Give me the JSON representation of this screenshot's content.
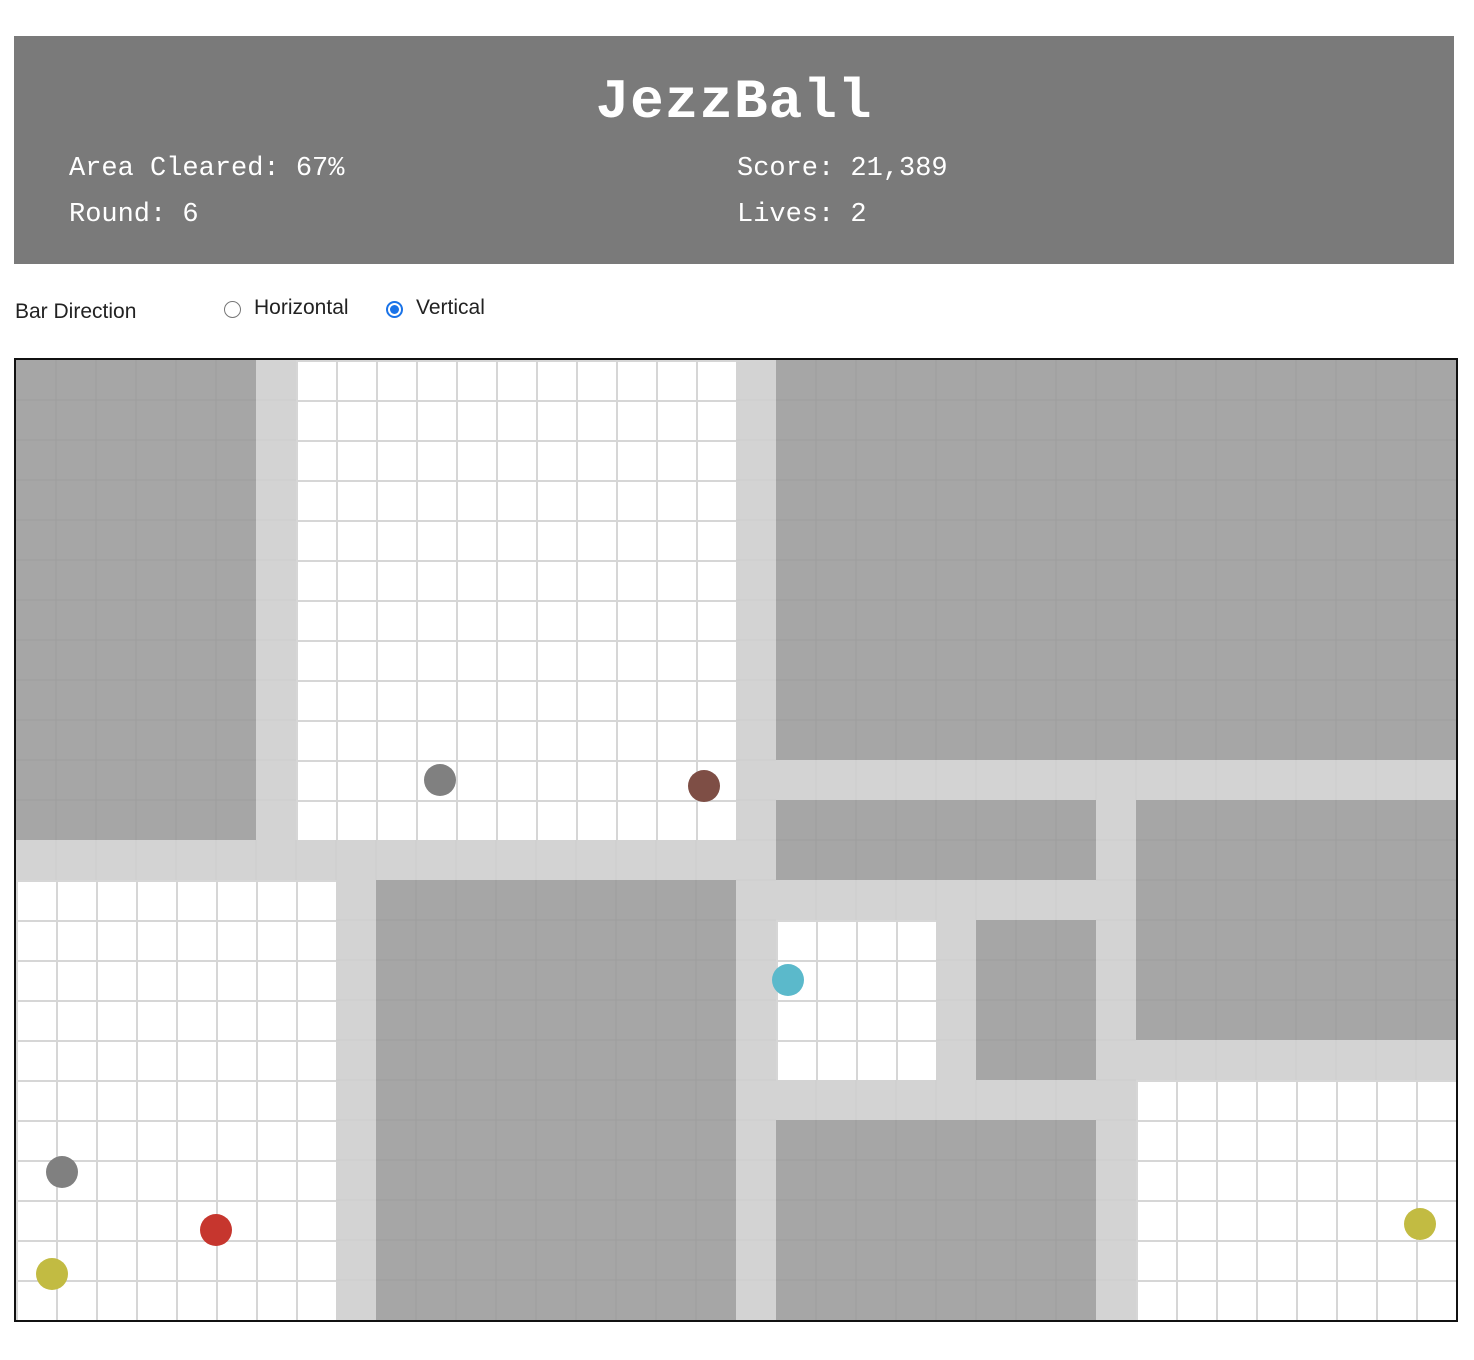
{
  "game": {
    "title": "JezzBall",
    "stats": {
      "area_cleared": "Area Cleared: 67%",
      "score": "Score: 21,389",
      "round": "Round: 6",
      "lives": "Lives: 2"
    }
  },
  "controls": {
    "bar_direction_label": "Bar Direction",
    "options": [
      {
        "label": "Horizontal",
        "checked": false
      },
      {
        "label": "Vertical",
        "checked": true
      }
    ]
  },
  "board": {
    "columns": 36,
    "rows": 24,
    "colors": {
      "filled": "#a6a6a6",
      "wall": "#d3d3d3",
      "open": "#ffffff",
      "gridline": "#d6d6d6"
    },
    "regions": [
      {
        "type": "filled",
        "col": 0,
        "row": 0,
        "cols": 6,
        "rows": 12
      },
      {
        "type": "wall",
        "col": 6,
        "row": 0,
        "cols": 1,
        "rows": 12
      },
      {
        "type": "open",
        "col": 7,
        "row": 0,
        "cols": 11,
        "rows": 12
      },
      {
        "type": "wall",
        "col": 18,
        "row": 0,
        "cols": 1,
        "rows": 24
      },
      {
        "type": "filled",
        "col": 19,
        "row": 0,
        "cols": 17,
        "rows": 10
      },
      {
        "type": "wall",
        "col": 19,
        "row": 10,
        "cols": 17,
        "rows": 1
      },
      {
        "type": "wall",
        "col": 0,
        "row": 12,
        "cols": 18,
        "rows": 1
      },
      {
        "type": "open",
        "col": 0,
        "row": 13,
        "cols": 8,
        "rows": 11
      },
      {
        "type": "wall",
        "col": 8,
        "row": 13,
        "cols": 1,
        "rows": 11
      },
      {
        "type": "filled",
        "col": 9,
        "row": 13,
        "cols": 9,
        "rows": 11
      },
      {
        "type": "filled",
        "col": 19,
        "row": 11,
        "cols": 8,
        "rows": 2
      },
      {
        "type": "wall",
        "col": 27,
        "row": 11,
        "cols": 1,
        "rows": 13
      },
      {
        "type": "filled",
        "col": 28,
        "row": 11,
        "cols": 8,
        "rows": 6
      },
      {
        "type": "wall",
        "col": 19,
        "row": 13,
        "cols": 8,
        "rows": 1
      },
      {
        "type": "open",
        "col": 19,
        "row": 14,
        "cols": 4,
        "rows": 4
      },
      {
        "type": "wall",
        "col": 23,
        "row": 14,
        "cols": 1,
        "rows": 4
      },
      {
        "type": "filled",
        "col": 24,
        "row": 14,
        "cols": 3,
        "rows": 4
      },
      {
        "type": "wall",
        "col": 19,
        "row": 18,
        "cols": 8,
        "rows": 1
      },
      {
        "type": "filled",
        "col": 19,
        "row": 19,
        "cols": 8,
        "rows": 5
      },
      {
        "type": "wall",
        "col": 28,
        "row": 17,
        "cols": 8,
        "rows": 1
      },
      {
        "type": "open",
        "col": 28,
        "row": 18,
        "cols": 8,
        "rows": 6
      }
    ],
    "balls": [
      {
        "color": "#808080",
        "col": 10.6,
        "row": 10.5
      },
      {
        "color": "#7e4e45",
        "col": 17.2,
        "row": 10.65
      },
      {
        "color": "#5bb9cb",
        "col": 19.3,
        "row": 15.5
      },
      {
        "color": "#808080",
        "col": 1.15,
        "row": 20.3
      },
      {
        "color": "#c6362e",
        "col": 5.0,
        "row": 21.75
      },
      {
        "color": "#c2bb42",
        "col": 0.9,
        "row": 22.85
      },
      {
        "color": "#c2bb42",
        "col": 35.1,
        "row": 21.6
      }
    ]
  }
}
